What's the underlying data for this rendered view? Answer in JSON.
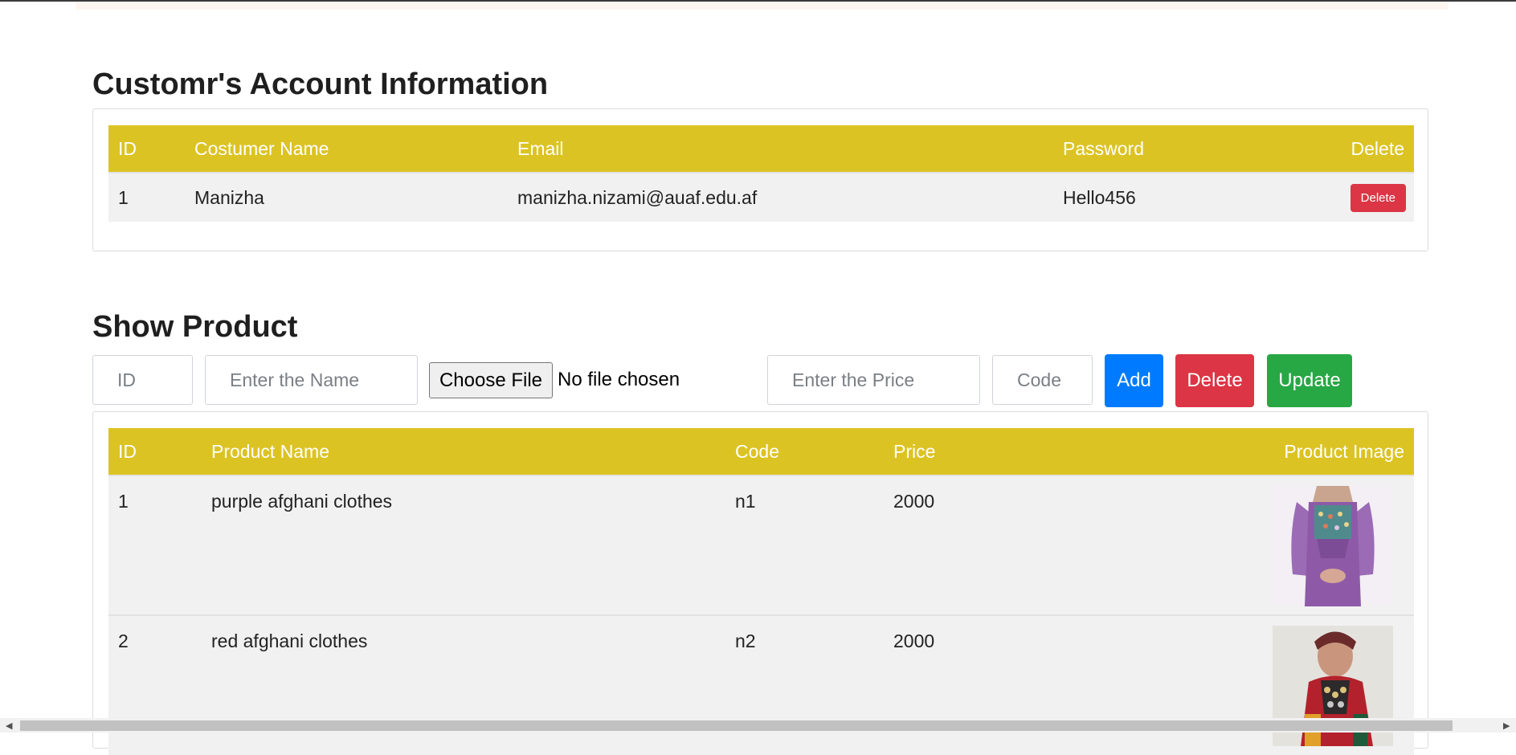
{
  "accounts": {
    "title": "Customr's Account Information",
    "headers": {
      "id": "ID",
      "name": "Costumer Name",
      "email": "Email",
      "password": "Password",
      "delete": "Delete"
    },
    "rows": [
      {
        "id": "1",
        "name": "Manizha",
        "email": "manizha.nizami@auaf.edu.af",
        "password": "Hello456",
        "delete_label": "Delete"
      }
    ]
  },
  "products": {
    "title": "Show Product",
    "form": {
      "id_placeholder": "ID",
      "name_placeholder": "Enter the Name",
      "file_button": "Choose File",
      "file_status": "No file chosen",
      "price_placeholder": "Enter the Price",
      "code_placeholder": "Code",
      "add_label": "Add",
      "delete_label": "Delete",
      "update_label": "Update"
    },
    "headers": {
      "id": "ID",
      "name": "Product Name",
      "code": "Code",
      "price": "Price",
      "image": "Product Image"
    },
    "rows": [
      {
        "id": "1",
        "name": "purple afghani clothes",
        "code": "n1",
        "price": "2000",
        "image": "purple-dress-photo"
      },
      {
        "id": "2",
        "name": "red afghani clothes",
        "code": "n2",
        "price": "2000",
        "image": "red-dress-photo"
      }
    ]
  },
  "colors": {
    "table_header": "#dcc324",
    "add": "#007bff",
    "delete": "#dc3545",
    "update": "#28a745"
  }
}
